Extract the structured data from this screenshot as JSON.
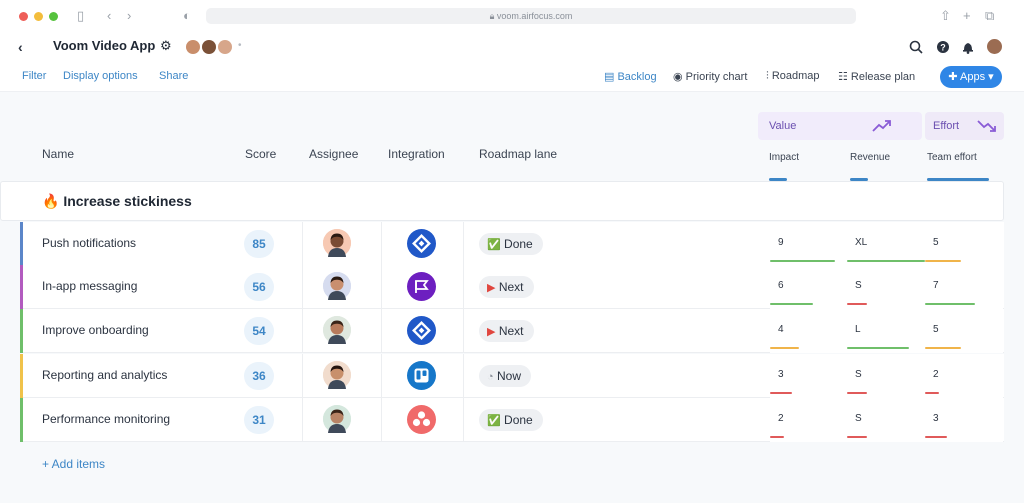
{
  "browser": {
    "url": "voom.airfocus.com"
  },
  "header": {
    "back": "‹",
    "title": "Voom Video App",
    "gear": "⚙",
    "more_dot": "•"
  },
  "toolbar": {
    "filter": "Filter",
    "display_options": "Display options",
    "share": "Share",
    "views": [
      "Backlog",
      "Priority chart",
      "Roadmap",
      "Release plan"
    ],
    "apps": "Apps"
  },
  "columns": {
    "name": "Name",
    "score": "Score",
    "assignee": "Assignee",
    "integration": "Integration",
    "roadmap_lane": "Roadmap lane"
  },
  "metric_groups": {
    "value": {
      "label": "Value",
      "subs": [
        "Impact",
        "Revenue"
      ]
    },
    "effort": {
      "label": "Effort",
      "subs": [
        "Team effort"
      ]
    }
  },
  "section": {
    "title": "Increase stickiness",
    "icon": "🔥"
  },
  "rows": [
    {
      "name": "Push notifications",
      "score": "85",
      "lane": "Done",
      "lane_icon": "✅",
      "impact": "9",
      "revenue": "XL",
      "effort": "5",
      "bar": "#5b86c9",
      "integration": "jira"
    },
    {
      "name": "In-app messaging",
      "score": "56",
      "lane": "Next",
      "lane_icon": "▶",
      "impact": "6",
      "revenue": "S",
      "effort": "7",
      "bar": "#b25bbf",
      "integration": "flag"
    },
    {
      "name": "Improve onboarding",
      "score": "54",
      "lane": "Next",
      "lane_icon": "▶",
      "impact": "4",
      "revenue": "L",
      "effort": "5",
      "bar": "#6fbf6a",
      "integration": "jira"
    },
    {
      "name": "Reporting and analytics",
      "score": "36",
      "lane": "Now",
      "lane_icon": "◔",
      "impact": "3",
      "revenue": "S",
      "effort": "2",
      "bar": "#f0c24a",
      "integration": "trello"
    },
    {
      "name": "Performance monitoring",
      "score": "31",
      "lane": "Done",
      "lane_icon": "✅",
      "impact": "2",
      "revenue": "S",
      "effort": "3",
      "bar": "#6fbf6a",
      "integration": "asana"
    }
  ],
  "add_items": "+ Add items",
  "colors": {
    "accent": "#3d86c6",
    "value_group": "#f1ecfb",
    "effort_group": "#efeaf8",
    "purple": "#8a5cd6"
  }
}
